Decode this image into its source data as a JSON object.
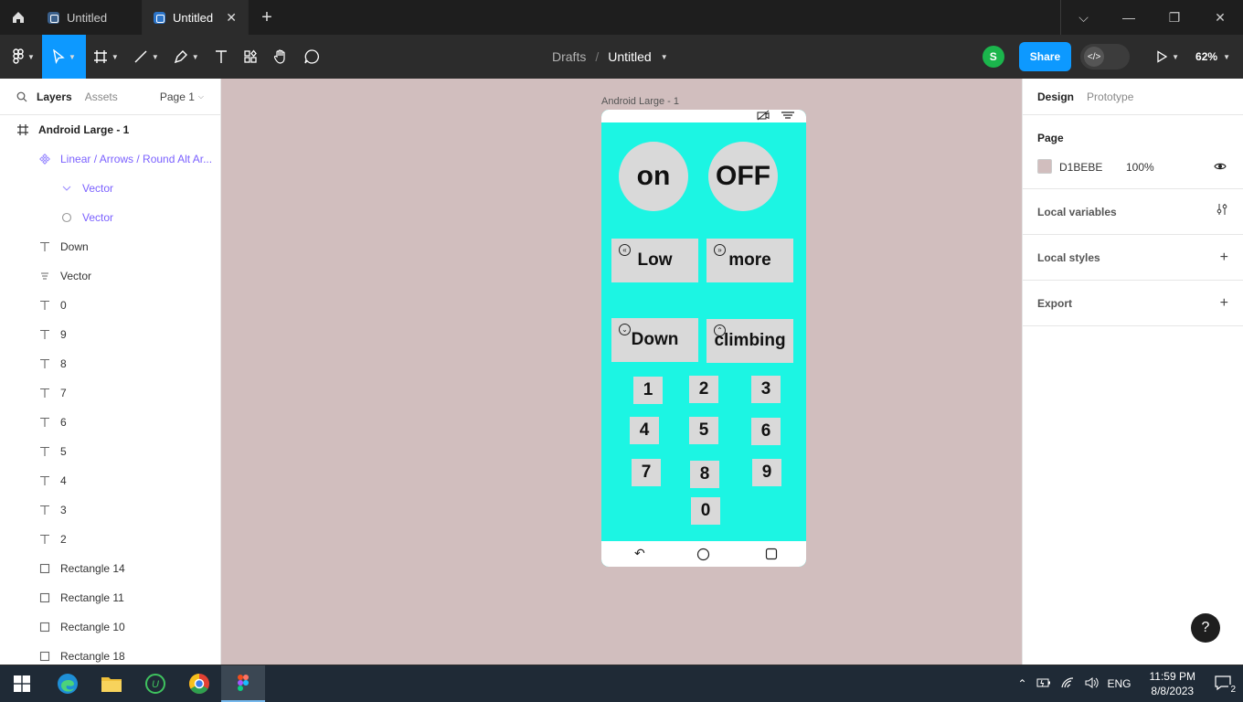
{
  "titlebar": {
    "tabs": [
      {
        "label": "Untitled",
        "active": false
      },
      {
        "label": "Untitled",
        "active": true
      }
    ]
  },
  "toolbar": {
    "breadcrumb_root": "Drafts",
    "file_name": "Untitled",
    "avatar_initial": "S",
    "share_label": "Share",
    "zoom": "62%"
  },
  "left_panel": {
    "tab_layers": "Layers",
    "tab_assets": "Assets",
    "page_selector": "Page 1",
    "layers": [
      {
        "name": "Android Large - 1",
        "icon": "frame-icon",
        "indent": 0
      },
      {
        "name": "Linear / Arrows / Round Alt Ar...",
        "icon": "component-icon",
        "indent": 1
      },
      {
        "name": "Vector",
        "icon": "vector-chevron-icon",
        "indent": 2
      },
      {
        "name": "Vector",
        "icon": "vector-ellipse-icon",
        "indent": 2
      },
      {
        "name": "Down",
        "icon": "text-icon",
        "indent": 1
      },
      {
        "name": "Vector",
        "icon": "vector-lines-icon",
        "indent": 1
      },
      {
        "name": "0",
        "icon": "text-icon",
        "indent": 1
      },
      {
        "name": "9",
        "icon": "text-icon",
        "indent": 1
      },
      {
        "name": "8",
        "icon": "text-icon",
        "indent": 1
      },
      {
        "name": "7",
        "icon": "text-icon",
        "indent": 1
      },
      {
        "name": "6",
        "icon": "text-icon",
        "indent": 1
      },
      {
        "name": "5",
        "icon": "text-icon",
        "indent": 1
      },
      {
        "name": "4",
        "icon": "text-icon",
        "indent": 1
      },
      {
        "name": "3",
        "icon": "text-icon",
        "indent": 1
      },
      {
        "name": "2",
        "icon": "text-icon",
        "indent": 1
      },
      {
        "name": "Rectangle 14",
        "icon": "rectangle-icon",
        "indent": 1
      },
      {
        "name": "Rectangle 11",
        "icon": "rectangle-icon",
        "indent": 1
      },
      {
        "name": "Rectangle 10",
        "icon": "rectangle-icon",
        "indent": 1
      },
      {
        "name": "Rectangle 18",
        "icon": "rectangle-icon",
        "indent": 1
      }
    ]
  },
  "canvas": {
    "background": "#D1BEBE",
    "frame_label": "Android Large - 1",
    "phone": {
      "background": "#1CF5E3",
      "button_color": "#D9D9D9",
      "on_label": "on",
      "off_label": "OFF",
      "low_label": "Low",
      "more_label": "more",
      "down_label": "Down",
      "climbing_label": "climbing",
      "keys": [
        "1",
        "2",
        "3",
        "4",
        "5",
        "6",
        "7",
        "8",
        "9",
        "0"
      ]
    }
  },
  "right_panel": {
    "tab_design": "Design",
    "tab_prototype": "Prototype",
    "page_title": "Page",
    "page_color": "D1BEBE",
    "page_opacity": "100%",
    "local_variables": "Local variables",
    "local_styles": "Local styles",
    "export": "Export"
  },
  "help_label": "?",
  "taskbar": {
    "language": "ENG",
    "time": "11:59 PM",
    "date": "8/8/2023",
    "notification_count": "2"
  }
}
